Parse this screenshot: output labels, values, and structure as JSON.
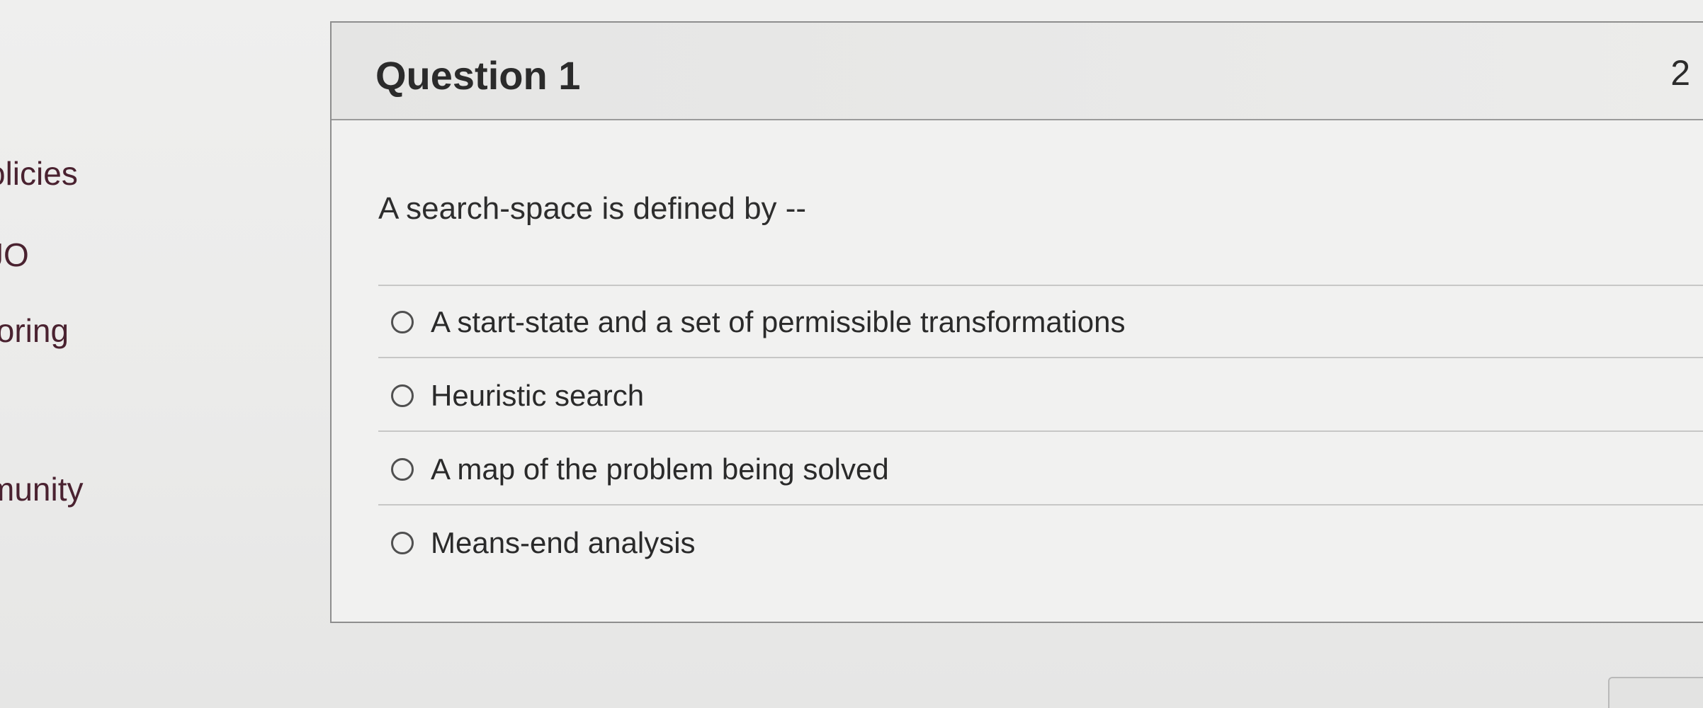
{
  "sidebar": {
    "items": [
      {
        "label": "olicies"
      },
      {
        "label": "JO"
      },
      {
        "label": "toring"
      },
      {
        "label": "munity"
      }
    ]
  },
  "question": {
    "title": "Question 1",
    "points": "2",
    "prompt": "A search-space is defined by --",
    "options": [
      {
        "label": "A start-state and a set of permissible transformations"
      },
      {
        "label": "Heuristic search"
      },
      {
        "label": "A map of the problem being solved"
      },
      {
        "label": "Means-end analysis"
      }
    ]
  }
}
